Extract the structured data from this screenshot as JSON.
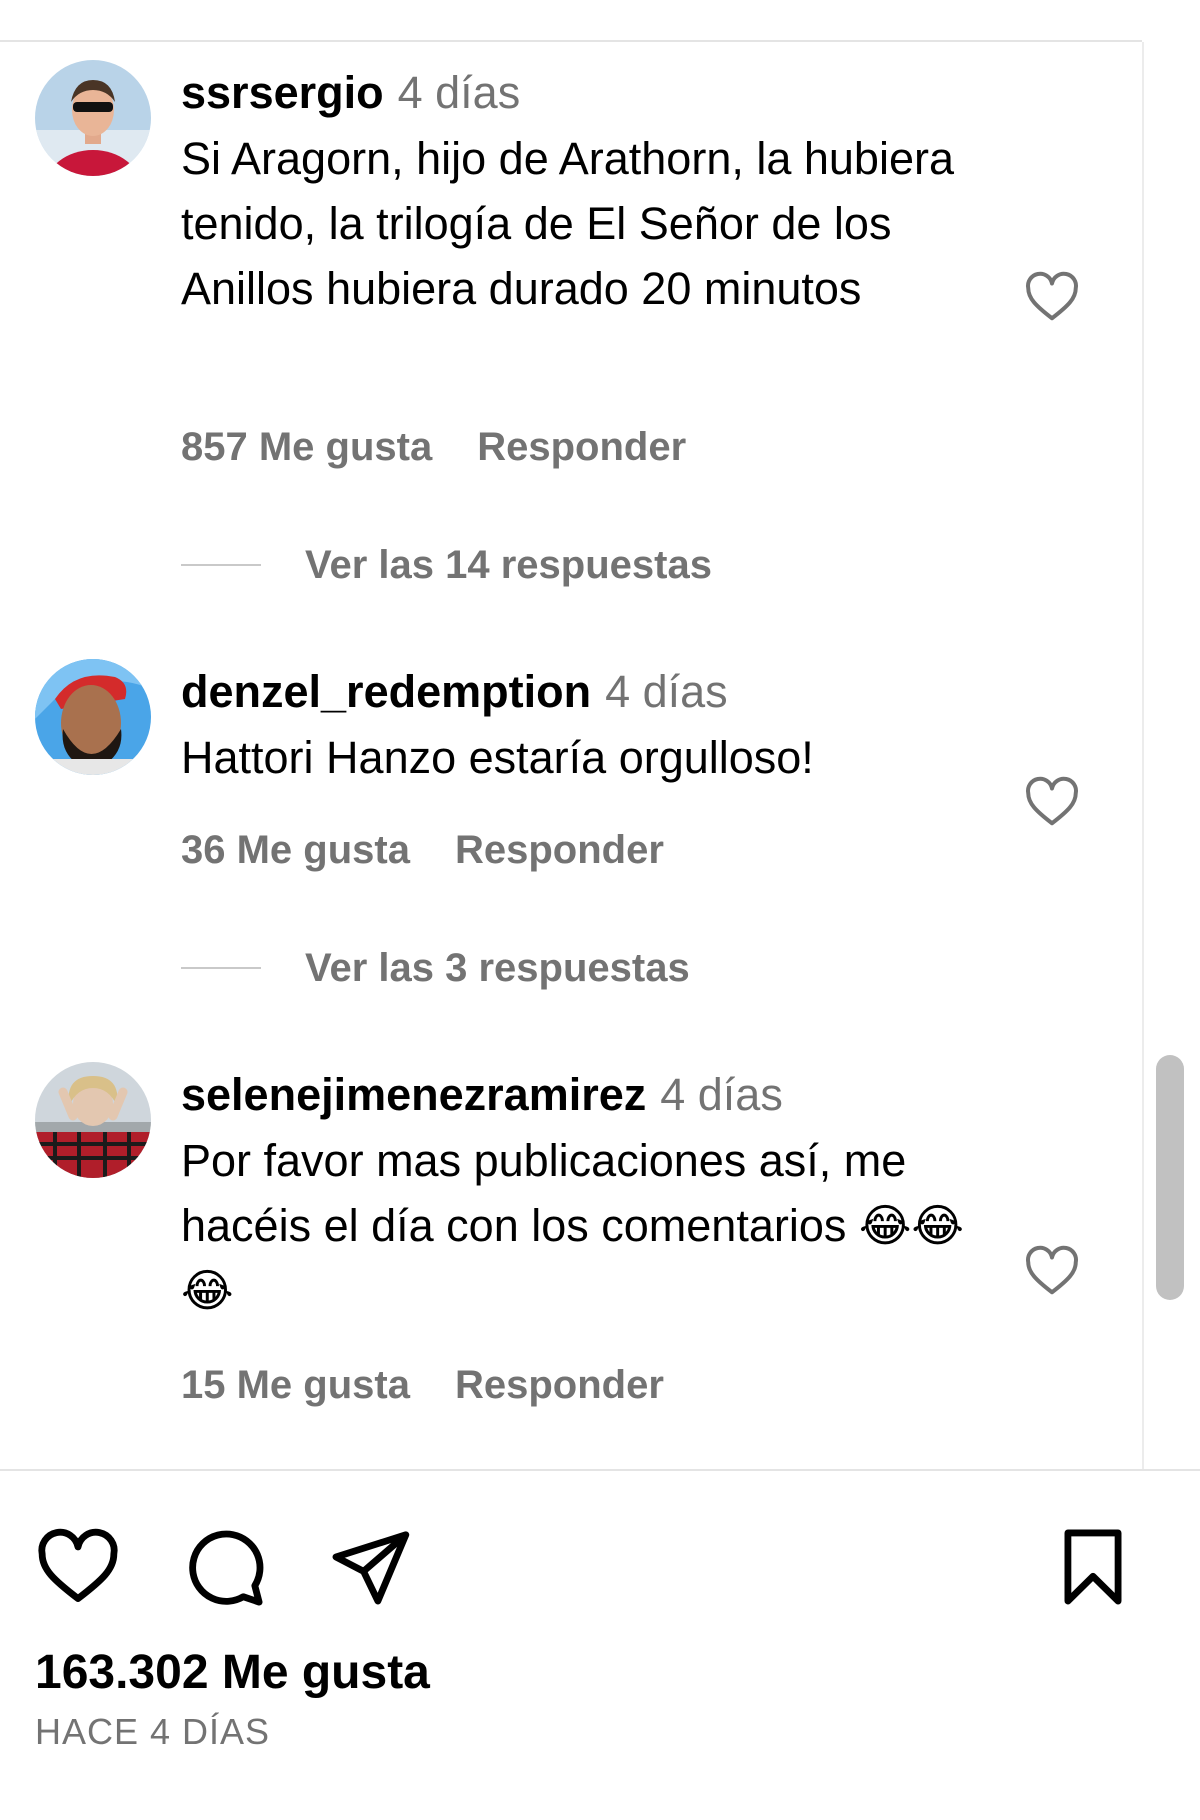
{
  "comments": [
    {
      "username": "ssrsergio",
      "time": "4 días",
      "text": "Si Aragorn, hijo de Arathorn, la hubiera tenido, la trilogía de El Señor de los Anillos hubiera durado 20 minutos",
      "likes": "857 Me gusta",
      "reply_label": "Responder",
      "view_replies": "Ver las 14 respuestas"
    },
    {
      "username": "denzel_redemption",
      "time": "4 días",
      "text": "Hattori Hanzo estaría orgulloso!",
      "likes": "36 Me gusta",
      "reply_label": "Responder",
      "view_replies": "Ver las 3 respuestas"
    },
    {
      "username": "selenejimenezramirez",
      "time": "4 días",
      "text": "Por favor mas publicaciones así, me hacéis el día con los comentarios 😂😂😂",
      "likes": "15 Me gusta",
      "reply_label": "Responder"
    }
  ],
  "post": {
    "likes_total": "163.302 Me gusta",
    "posted": "HACE 4 DÍAS"
  },
  "icons": {
    "like": "heart-icon",
    "comment": "comment-bubble-icon",
    "share": "paper-plane-icon",
    "save": "bookmark-icon"
  },
  "colors": {
    "secondary_text": "#737373",
    "primary_text": "#000000"
  }
}
